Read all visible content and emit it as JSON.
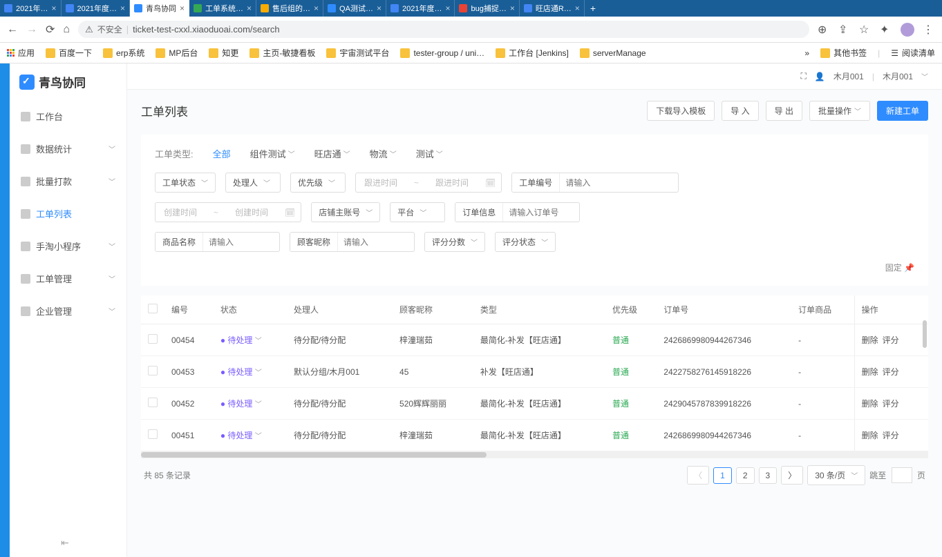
{
  "browser": {
    "tabs": [
      {
        "label": "2021年…",
        "icon": "#4285f4"
      },
      {
        "label": "2021年度…",
        "icon": "#4285f4"
      },
      {
        "label": "青鸟协同",
        "icon": "#2f8cff",
        "active": true
      },
      {
        "label": "工单系统…",
        "icon": "#34a853"
      },
      {
        "label": "售后组的…",
        "icon": "#f9ab00"
      },
      {
        "label": "QA测试…",
        "icon": "#2f8cff"
      },
      {
        "label": "2021年度…",
        "icon": "#4285f4"
      },
      {
        "label": "bug捕捉…",
        "icon": "#ea4335"
      },
      {
        "label": "旺店通R…",
        "icon": "#4285f4"
      }
    ],
    "insecure": "不安全",
    "url": "ticket-test-cxxl.xiaoduoai.com/search",
    "bookmarks": [
      "应用",
      "百度一下",
      "erp系统",
      "MP后台",
      "知更",
      "主页-敏捷看板",
      "宇宙测试平台",
      "tester-group / uni…",
      "工作台 [Jenkins]",
      "serverManage"
    ],
    "more_bm": "其他书签",
    "reading": "阅读清单"
  },
  "topbar": {
    "user1": "木月001",
    "user2": "木月001"
  },
  "sidebar": {
    "logo": "青鸟协同",
    "items": [
      {
        "label": "工作台",
        "expandable": false
      },
      {
        "label": "数据统计",
        "expandable": true
      },
      {
        "label": "批量打款",
        "expandable": true
      },
      {
        "label": "工单列表",
        "expandable": false,
        "active": true
      },
      {
        "label": "手淘小程序",
        "expandable": true
      },
      {
        "label": "工单管理",
        "expandable": true
      },
      {
        "label": "企业管理",
        "expandable": true
      }
    ]
  },
  "page": {
    "title": "工单列表",
    "actions": {
      "download_tpl": "下载导入模板",
      "import": "导 入",
      "export": "导 出",
      "batch": "批量操作",
      "create": "新建工单"
    }
  },
  "filters": {
    "type_label": "工单类型:",
    "types": [
      {
        "label": "全部",
        "active": true
      },
      {
        "label": "组件测试",
        "chev": true
      },
      {
        "label": "旺店通",
        "chev": true
      },
      {
        "label": "物流",
        "chev": true
      },
      {
        "label": "测试",
        "chev": true
      }
    ],
    "status": "工单状态",
    "handler": "处理人",
    "priority": "优先级",
    "follow_time": "跟进时间",
    "ticket_no_label": "工单编号",
    "ticket_no_ph": "请输入",
    "create_time": "创建时间",
    "shop_account": "店铺主账号",
    "platform": "平台",
    "order_info_label": "订单信息",
    "order_info_ph": "请输入订单号",
    "product_name_label": "商品名称",
    "product_name_ph": "请输入",
    "customer_nick_label": "顾客昵称",
    "customer_nick_ph": "请输入",
    "score": "评分分数",
    "score_status": "评分状态",
    "pin": "固定"
  },
  "table": {
    "headers": [
      "",
      "编号",
      "状态",
      "处理人",
      "顾客昵称",
      "类型",
      "优先级",
      "订单号",
      "订单商品",
      "操作"
    ],
    "rows": [
      {
        "no": "00454",
        "status": "待处理",
        "handler": "待分配/待分配",
        "nick": "梓潼瑞茹",
        "type": "最简化-补发【旺店通】",
        "priority": "普通",
        "order": "2426869980944267346",
        "goods": "-",
        "ops": [
          "删除",
          "评分"
        ]
      },
      {
        "no": "00453",
        "status": "待处理",
        "handler": "默认分组/木月001",
        "nick": "45",
        "type": "补发【旺店通】",
        "priority": "普通",
        "order": "2422758276145918226",
        "goods": "-",
        "ops": [
          "删除",
          "评分"
        ]
      },
      {
        "no": "00452",
        "status": "待处理",
        "handler": "待分配/待分配",
        "nick": "520辉辉丽丽",
        "type": "最简化-补发【旺店通】",
        "priority": "普通",
        "order": "2429045787839918226",
        "goods": "-",
        "ops": [
          "删除",
          "评分"
        ]
      },
      {
        "no": "00451",
        "status": "待处理",
        "handler": "待分配/待分配",
        "nick": "梓潼瑞茹",
        "type": "最简化-补发【旺店通】",
        "priority": "普通",
        "order": "2426869980944267346",
        "goods": "-",
        "ops": [
          "删除",
          "评分"
        ]
      }
    ]
  },
  "footer": {
    "total": "共 85 条记录",
    "pages": [
      "1",
      "2",
      "3"
    ],
    "page_size": "30 条/页",
    "jump": "跳至",
    "page_suffix": "页"
  }
}
